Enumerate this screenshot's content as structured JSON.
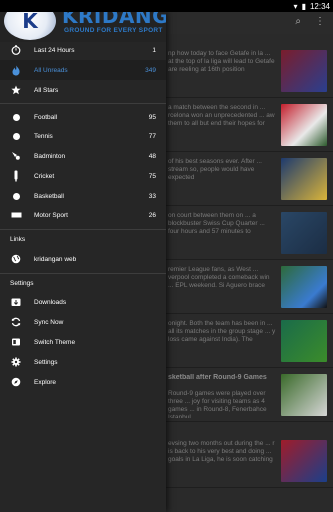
{
  "status": {
    "time": "12:34"
  },
  "header": {
    "brand": "KRIDANGAN",
    "tagline": "GROUND FOR EVERY SPORT",
    "logo_letter": "K"
  },
  "menu": {
    "top": [
      {
        "label": "Last 24 Hours",
        "count": "1",
        "icon": "stopwatch-icon"
      },
      {
        "label": "All Unreads",
        "count": "349",
        "icon": "fire-icon",
        "selected": true
      },
      {
        "label": "All Stars",
        "count": "",
        "icon": "star-icon"
      }
    ],
    "sports": [
      {
        "label": "Football",
        "count": "95",
        "icon": "football-icon"
      },
      {
        "label": "Tennis",
        "count": "77",
        "icon": "tennis-icon"
      },
      {
        "label": "Badminton",
        "count": "48",
        "icon": "shuttlecock-icon"
      },
      {
        "label": "Cricket",
        "count": "75",
        "icon": "cricket-bat-icon"
      },
      {
        "label": "Basketball",
        "count": "33",
        "icon": "basketball-icon"
      },
      {
        "label": "Motor Sport",
        "count": "26",
        "icon": "motorsport-icon"
      }
    ],
    "links_title": "Links",
    "links": [
      {
        "label": "kridangan web",
        "icon": "globe-icon"
      }
    ],
    "settings_title": "Settings",
    "settings": [
      {
        "label": "Downloads",
        "icon": "download-icon"
      },
      {
        "label": "Sync Now",
        "icon": "sync-icon"
      },
      {
        "label": "Switch Theme",
        "icon": "theme-icon"
      },
      {
        "label": "Settings",
        "icon": "gear-icon"
      },
      {
        "label": "Explore",
        "icon": "compass-icon"
      }
    ]
  },
  "feed": [
    {
      "text": "np how today to face Getafe in la ... at the top of la liga will lead to Getafe are reeling at 16th position",
      "bold": false
    },
    {
      "text": "a match between the second in ... rcelona won an unprecedented ... aw them to all but end their hopes for",
      "bold": false
    },
    {
      "text": "of his best seasons ever. After ... stream so, people would have expected",
      "bold": false
    },
    {
      "text": "on court between them on ... a blockbuster Swiss Cup Quarter ... four hours and 57 minutes to",
      "bold": false
    },
    {
      "text": "remier League fans, as West ... verpool completed a comeback win ... EPL weekend. Si Aguero brace",
      "bold": false
    },
    {
      "text": "onight. Both the team has been in ... all its matches in the group stage ... y loss came against India). The",
      "bold": false
    },
    {
      "text": "sketball after Round-9 Games",
      "bold": true
    },
    {
      "text": "Round-9 games were played over three ... joy for visiting teams as 4 games ... in Round-8, Fenerbahce Istanbul",
      "bold": false
    },
    {
      "text": "evsing two months out during the ... r is back to his very best and doing ... goals in La Liga, he is soon catching",
      "bold": false
    }
  ]
}
